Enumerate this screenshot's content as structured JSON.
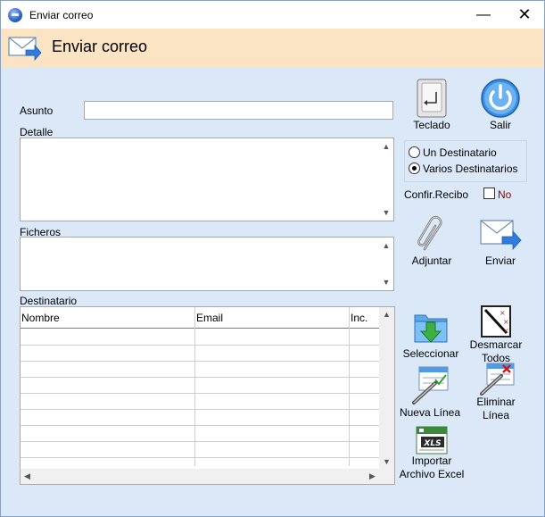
{
  "window": {
    "title": "Enviar correo",
    "minimize_glyph": "—",
    "close_glyph": "✕"
  },
  "header": {
    "title": "Enviar correo",
    "icon": "mail-arrow-icon"
  },
  "form": {
    "asunto_label": "Asunto",
    "asunto_value": "",
    "detalle_label": "Detalle",
    "detalle_value": "",
    "ficheros_label": "Ficheros",
    "ficheros_value": "",
    "destinatario_label": "Destinatario"
  },
  "table": {
    "columns": [
      "Nombre",
      "Email",
      "Inc."
    ],
    "rows": []
  },
  "scroll": {
    "up": "▲",
    "down": "▼",
    "left": "◀",
    "right": "▶"
  },
  "tools": {
    "teclado": "Teclado",
    "salir": "Salir",
    "adjuntar": "Adjuntar",
    "enviar": "Enviar",
    "seleccionar": "Seleccionar",
    "desmarcar_1": "Desmarcar",
    "desmarcar_2": "Todos",
    "nueva_linea": "Nueva Línea",
    "eliminar_1": "Eliminar",
    "eliminar_2": "Línea",
    "importar_1": "Importar",
    "importar_2": "Archivo Excel"
  },
  "options": {
    "un_destinatario": "Un Destinatario",
    "varios_destinatarios": "Varios Destinatarios",
    "selected": "Varios Destinatarios",
    "confir_label": "Confir.Recibo",
    "confir_value": "No"
  },
  "colors": {
    "window_bg": "#dbe8f7",
    "header_bg": "#fbe4c4",
    "no_text": "#a00000"
  }
}
